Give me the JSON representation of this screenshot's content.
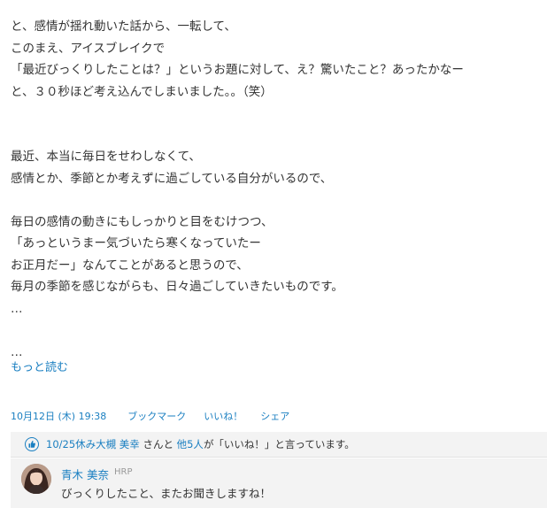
{
  "post": {
    "paragraph1": [
      "と、感情が揺れ動いた話から、一転して、",
      "このまえ、アイスブレイクで",
      "「最近びっくりしたことは？」というお題に対して、え？驚いたこと？あったかなー",
      "と、３０秒ほど考え込んでしまいました。。（笑）"
    ],
    "paragraph2": [
      "最近、本当に毎日をせわしなくて、",
      "感情とか、季節とか考えずに過ごしている自分がいるので、"
    ],
    "paragraph3": [
      "毎日の感情の動きにもしっかりと目をむけつつ、",
      "「あっというまー気づいたら寒くなっていたー",
      "お正月だー」なんてことがあると思うので、",
      "毎月の季節を感じながらも、日々過ごしていきたいものです。",
      "…"
    ],
    "ellipsis": "…",
    "more_label": "もっと読む"
  },
  "meta": {
    "date": "10月12日 (木) 19:38",
    "bookmark": "ブックマーク",
    "like": "いいね！",
    "share": "シェア"
  },
  "likes": {
    "first_user": "10/25休み大槻 美幸",
    "san_to": " さんと ",
    "others": "他5人",
    "suffix": "が「いいね！」と言っています。",
    "icon": "thumbs-up-icon",
    "icon_color": "#1a7fc1"
  },
  "comment": {
    "author": "青木 美奈",
    "tag": "HRP",
    "text": "びっくりしたこと、またお聞きしますね！"
  },
  "colors": {
    "link": "#1a7fc1",
    "text": "#333333",
    "panel": "#f3f3f3"
  }
}
